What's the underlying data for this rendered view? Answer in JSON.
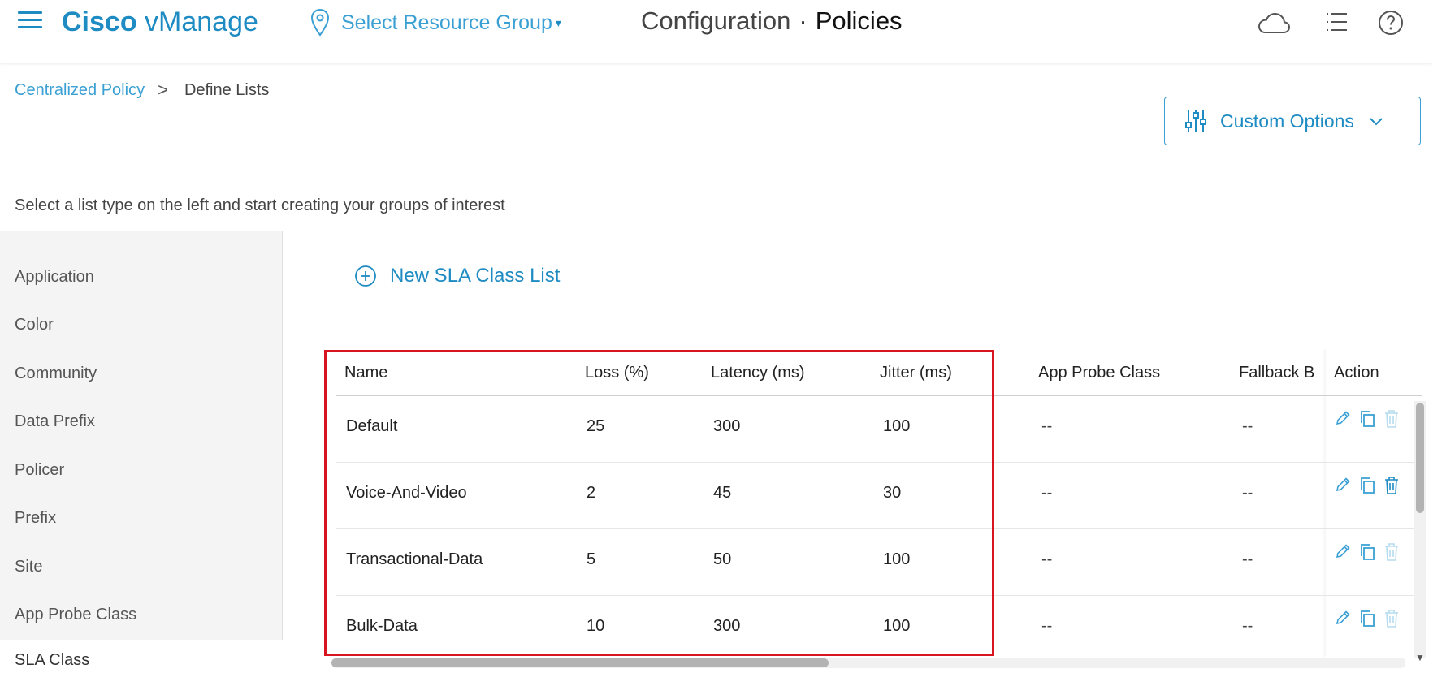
{
  "header": {
    "brand_bold": "Cisco",
    "brand_light": " vManage",
    "resource_group": "Select Resource Group",
    "resource_caret": "▾",
    "title_section": "Configuration",
    "title_dot": "·",
    "title_page": "Policies",
    "icons": [
      "menu-icon",
      "location-pin-icon",
      "cloud-icon",
      "list-icon",
      "help-icon"
    ]
  },
  "breadcrumb": {
    "parent": "Centralized Policy",
    "separator": ">",
    "current": "Define Lists"
  },
  "custom_options": {
    "label": "Custom Options",
    "icon": "sliders-icon"
  },
  "hint": "Select a list type on the left and start creating your groups of interest",
  "sidebar": {
    "items": [
      {
        "label": "Application"
      },
      {
        "label": "Color"
      },
      {
        "label": "Community"
      },
      {
        "label": "Data Prefix"
      },
      {
        "label": "Policer"
      },
      {
        "label": "Prefix"
      },
      {
        "label": "Site"
      },
      {
        "label": "App Probe Class"
      },
      {
        "label": "SLA Class"
      }
    ],
    "active": "SLA Class"
  },
  "new_list": {
    "label": "New SLA Class List",
    "icon": "plus-circle-icon"
  },
  "table": {
    "columns": [
      "Name",
      "Loss (%)",
      "Latency (ms)",
      "Jitter (ms)",
      "App Probe Class",
      "Fallback B",
      "Action"
    ],
    "rows": [
      {
        "name": "Default",
        "loss": "25",
        "latency": "300",
        "jitter": "100",
        "probe": "--",
        "fallback": "--"
      },
      {
        "name": "Voice-And-Video",
        "loss": "2",
        "latency": "45",
        "jitter": "30",
        "probe": "--",
        "fallback": "--"
      },
      {
        "name": "Transactional-Data",
        "loss": "5",
        "latency": "50",
        "jitter": "100",
        "probe": "--",
        "fallback": "--"
      },
      {
        "name": "Bulk-Data",
        "loss": "10",
        "latency": "300",
        "jitter": "100",
        "probe": "--",
        "fallback": "--"
      }
    ],
    "actions": [
      "edit-icon",
      "copy-icon",
      "delete-icon"
    ]
  },
  "colors": {
    "accent": "#1e8bc3",
    "link": "#3aa0d4",
    "highlight": "#d7141f",
    "sidebar_bg": "#f4f4f4"
  }
}
